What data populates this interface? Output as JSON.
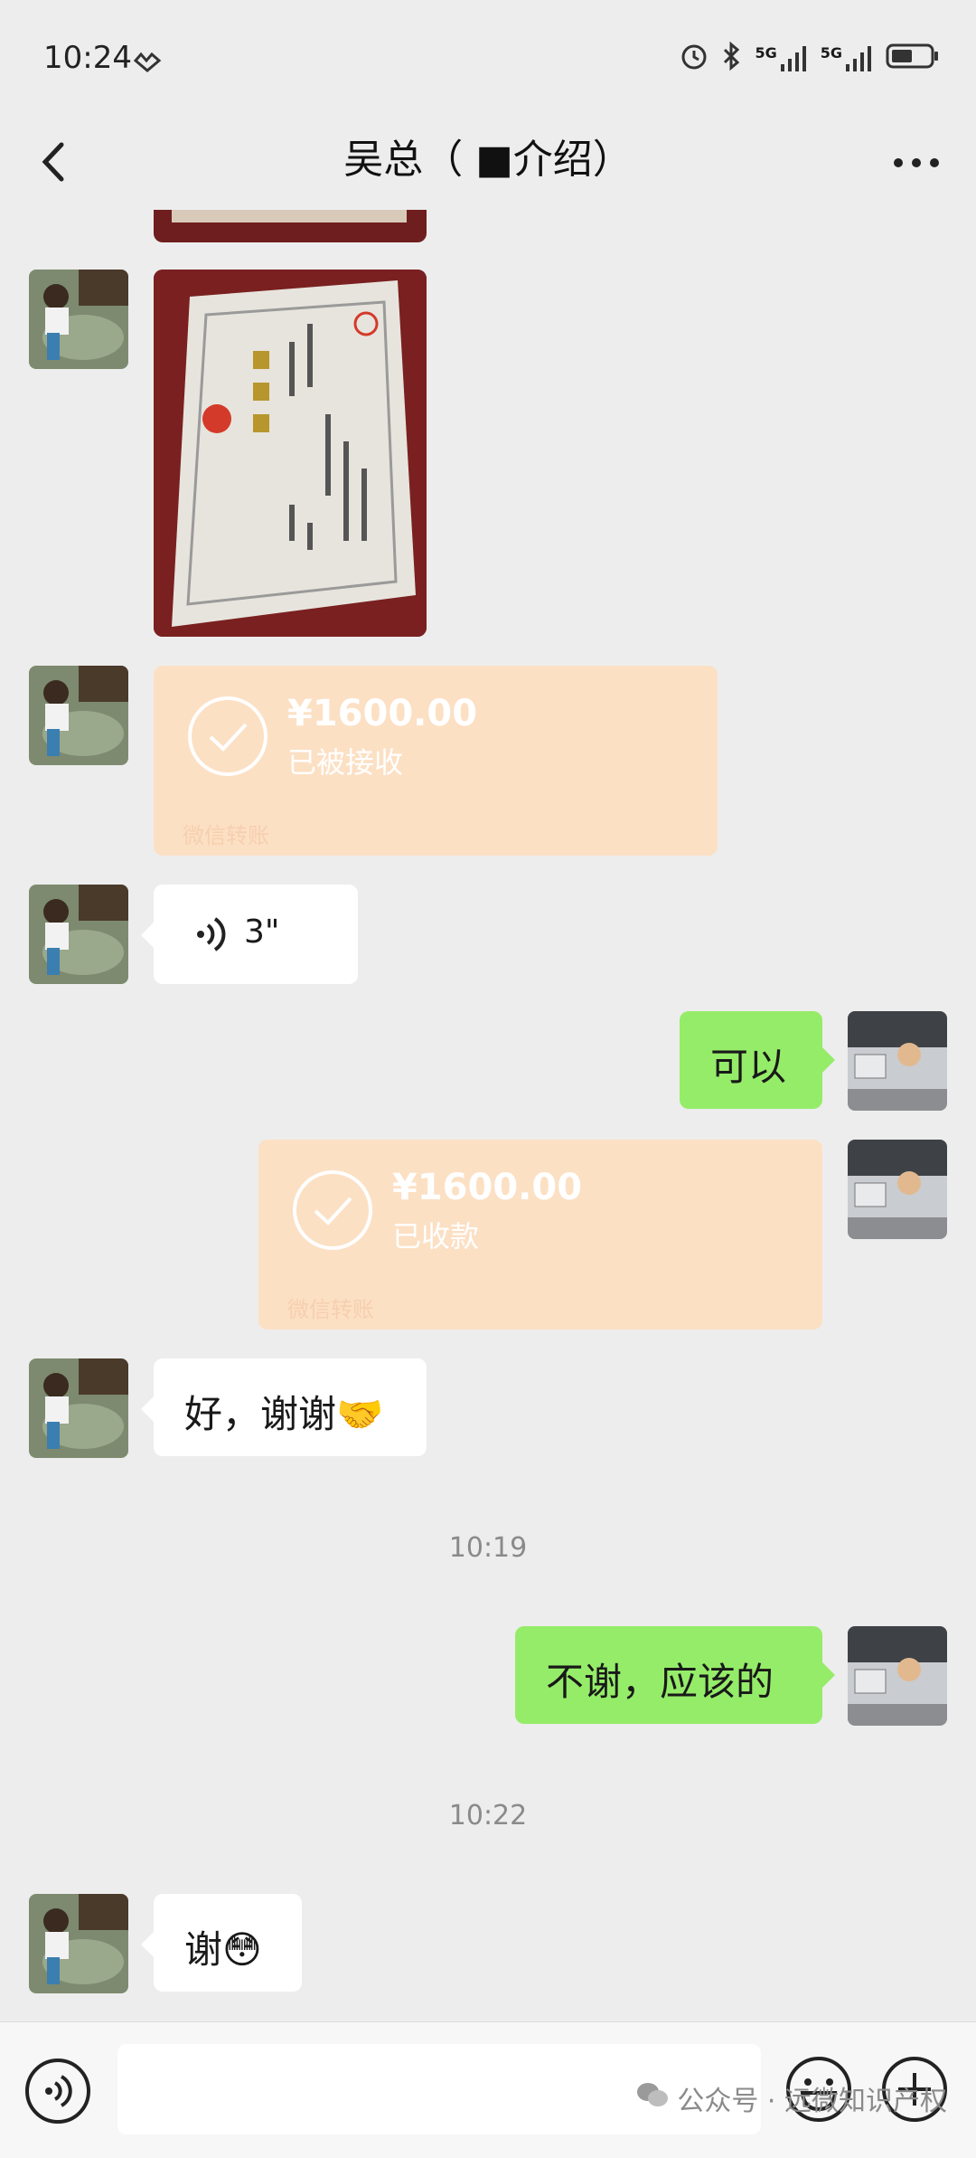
{
  "status": {
    "time": "10:24",
    "net1": "5G",
    "net2": "5G"
  },
  "nav": {
    "title": "吴总（ ■介绍）"
  },
  "messages": {
    "transfer1": {
      "amount": "¥1600.00",
      "state": "已被接收",
      "source": "微信转账"
    },
    "voice": {
      "duration": "3\""
    },
    "reply1": {
      "text": "可以"
    },
    "transfer2": {
      "amount": "¥1600.00",
      "state": "已收款",
      "source": "微信转账"
    },
    "thanks": {
      "text": "好，谢谢🤝"
    },
    "time1": "10:19",
    "reply2": {
      "text": "不谢，应该的"
    },
    "time2": "10:22",
    "last": {
      "text": "谢😳"
    }
  },
  "footer": {
    "watermark": "公众号 · 远微知识产权"
  },
  "colors": {
    "green_bubble": "#95ec69",
    "transfer": "#fce0c4",
    "background": "#ededed"
  }
}
